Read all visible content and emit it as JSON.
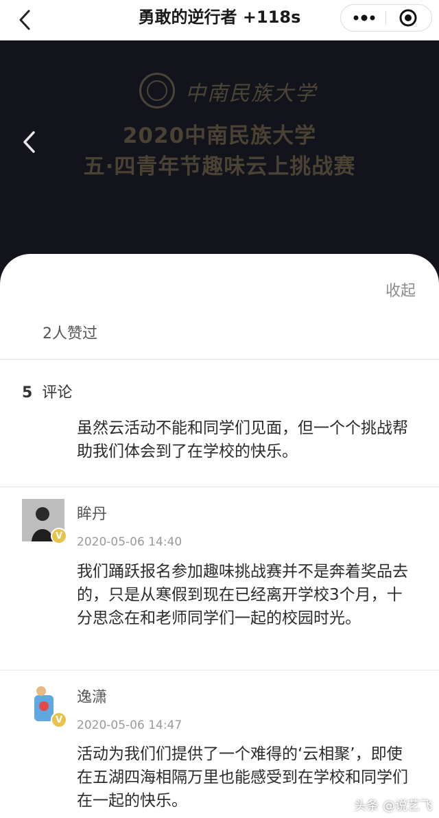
{
  "header": {
    "title": "勇敢的逆行者 +118s",
    "back_icon": "chevron-left-icon",
    "more_icon": "more-dots-icon",
    "close_icon": "target-close-icon"
  },
  "banner": {
    "university_name": "中南民族大学",
    "line1": "2020中南民族大学",
    "line2": "五·四青年节趣味云上挑战赛",
    "back_icon": "chevron-left-icon",
    "background": "#13131c",
    "text_color": "#4a4334"
  },
  "sheet": {
    "collapse_label": "收起",
    "likes_text": "2人赞过",
    "comment_count": "5",
    "comment_label": "评论",
    "comments": [
      {
        "name": "",
        "time": "",
        "text": "虽然云活动不能和同学们见面，但一个个挑战帮助我们体会到了在学校的快乐。"
      },
      {
        "name": "眸丹",
        "time": "2020-05-06 14:40",
        "text": "我们踊跃报名参加趣味挑战赛并不是奔着奖品去的，只是从寒假到现在已经离开学校3个月，十分思念在和老师同学们一起的校园时光。",
        "badge": "V"
      },
      {
        "name": "逸潇",
        "time": "2020-05-06 14:47",
        "text": "活动为我们们提供了一个难得的‘云相聚’，即使在五湖四海相隔万里也能感受到在学校和同学们在一起的快乐。",
        "badge": "V"
      }
    ]
  },
  "watermark": "头条 @说艺飞"
}
